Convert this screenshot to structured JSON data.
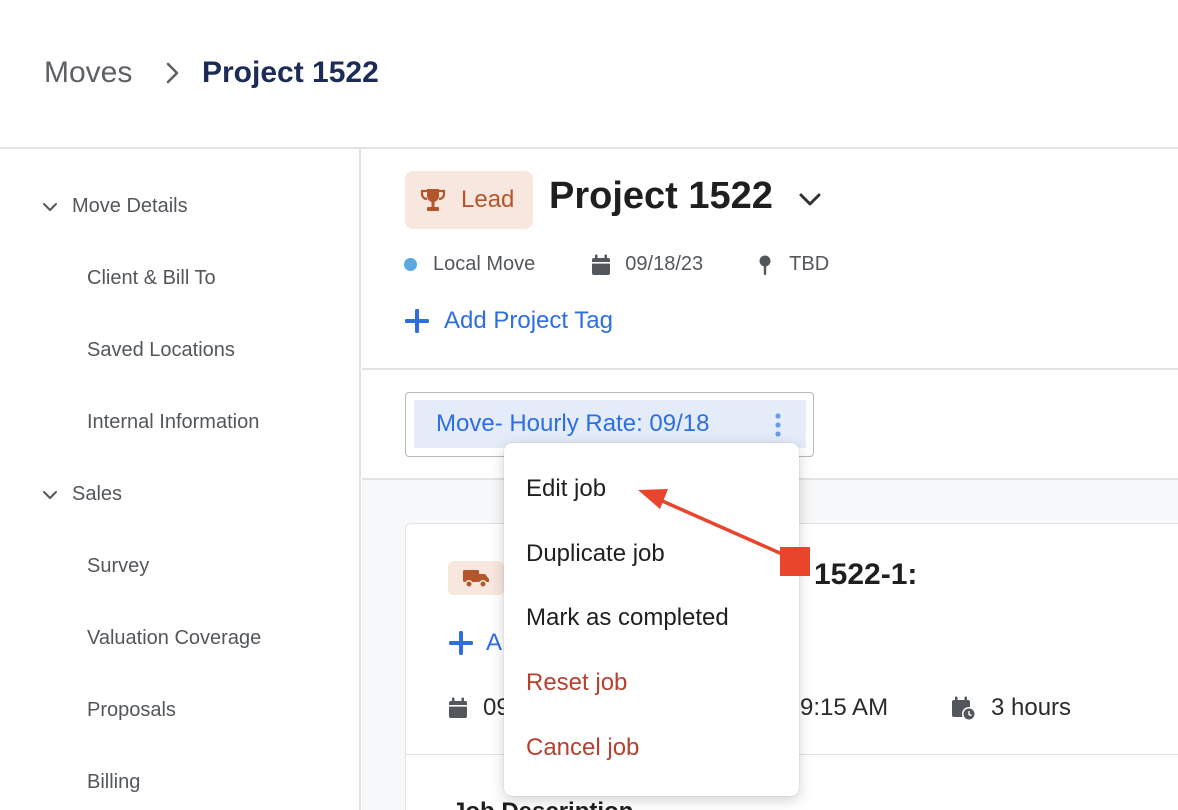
{
  "breadcrumb": {
    "root": "Moves",
    "current": "Project 1522"
  },
  "sidebar": {
    "groups": [
      {
        "label": "Move Details",
        "items": [
          "Client & Bill To",
          "Saved Locations",
          "Internal Information"
        ]
      },
      {
        "label": "Sales",
        "items": [
          "Survey",
          "Valuation Coverage",
          "Proposals",
          "Billing"
        ]
      }
    ]
  },
  "project": {
    "badge": "Lead",
    "title": "Project 1522",
    "move_type": "Local Move",
    "date": "09/18/23",
    "location": "TBD",
    "add_tag": "Add Project Tag"
  },
  "job_tab": {
    "label": "Move- Hourly Rate: 09/18"
  },
  "job_card": {
    "title_fragment": "1522-1:",
    "add_label_fragment": "A",
    "date_fragment": "09",
    "time_fragment": "9:15 AM",
    "duration": "3 hours",
    "description_fragment": "Job Description"
  },
  "context_menu": {
    "items": [
      {
        "label": "Edit job",
        "danger": false
      },
      {
        "label": "Duplicate job",
        "danger": false
      },
      {
        "label": "Mark as completed",
        "danger": false
      },
      {
        "label": "Reset job",
        "danger": true
      },
      {
        "label": "Cancel job",
        "danger": true
      }
    ]
  },
  "colors": {
    "accent_blue": "#2e6ee3",
    "title_navy": "#1d2b57",
    "lead_badge_bg": "#f8e7df",
    "lead_badge_fg": "#b5552c",
    "danger": "#b5412e",
    "annotation_red": "#e8452c",
    "move_dot": "#5aa8dd"
  },
  "icons": [
    "chevron-right-icon",
    "chevron-down-icon",
    "trophy-icon",
    "calendar-icon",
    "map-pin-icon",
    "plus-icon",
    "kebab-menu-icon",
    "truck-icon",
    "calendar-clock-icon",
    "annotation-arrow"
  ]
}
